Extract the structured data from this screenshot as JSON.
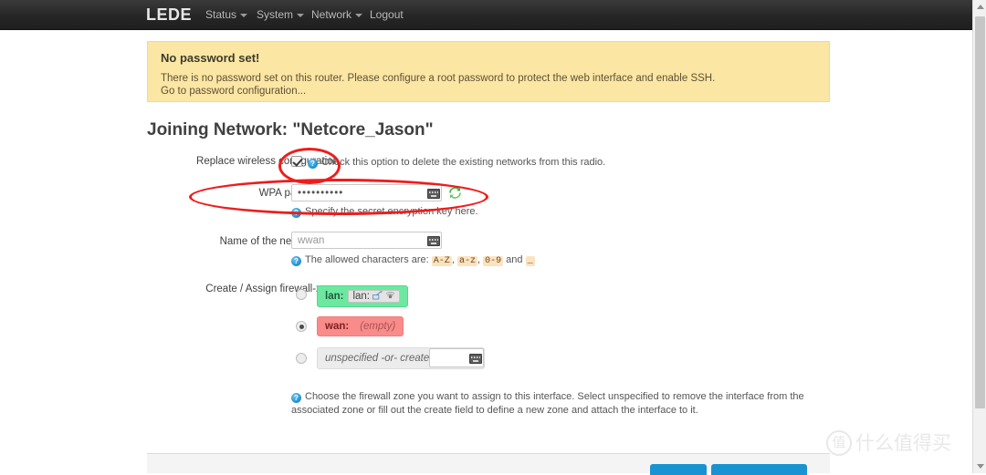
{
  "nav": {
    "brand": "LEDE",
    "items": [
      {
        "label": "Status",
        "caret": true
      },
      {
        "label": "System",
        "caret": true
      },
      {
        "label": "Network",
        "caret": true
      },
      {
        "label": "Logout",
        "caret": false
      }
    ]
  },
  "banner": {
    "title": "No password set!",
    "text": "There is no password set on this router. Please configure a root password to protect the web interface and enable SSH.",
    "link": "Go to password configuration..."
  },
  "page": {
    "title": "Joining Network: \"Netcore_Jason\""
  },
  "form": {
    "replace": {
      "label": "Replace wireless configuration",
      "checked": true,
      "help": "Check this option to delete the existing networks from this radio."
    },
    "passphrase": {
      "label": "WPA passphrase",
      "value": "••••••••••",
      "help": "Specify the secret encryption key here."
    },
    "network_name": {
      "label": "Name of the new network",
      "value": "wwan",
      "help_prefix": "The allowed characters are:",
      "help_chips": [
        "A-Z",
        "a-z",
        "0-9"
      ],
      "help_and": "and",
      "help_underscore": "_"
    },
    "firewall": {
      "label": "Create / Assign firewall-zone",
      "options": [
        {
          "id": "lan",
          "name": "lan:",
          "inner": "lan:",
          "selected": false
        },
        {
          "id": "wan",
          "name": "wan:",
          "inner": "(empty)",
          "selected": true
        },
        {
          "id": "unspecified",
          "name": "unspecified -or- create:",
          "inner": "",
          "selected": false
        }
      ],
      "create_value": "",
      "help_line1": "Choose the firewall zone you want to assign to this interface. Select unspecified to remove the interface from the associated",
      "help_line2": "zone or fill out the create field to define a new zone and attach the interface to it."
    }
  },
  "icons": {
    "help": "?",
    "keyboard": "keyboard-icon",
    "refresh": "refresh-icon",
    "caret": "chevron-down-icon"
  },
  "colors": {
    "navbar": "#262626",
    "banner_bg": "#fce6a4",
    "zone_lan": "#6ee8a0",
    "zone_wan": "#f98b8b",
    "button_blue": "#1793d1",
    "annotation_red": "#ee1c1c"
  },
  "watermark": {
    "mark": "值",
    "text": "什么值得买"
  }
}
